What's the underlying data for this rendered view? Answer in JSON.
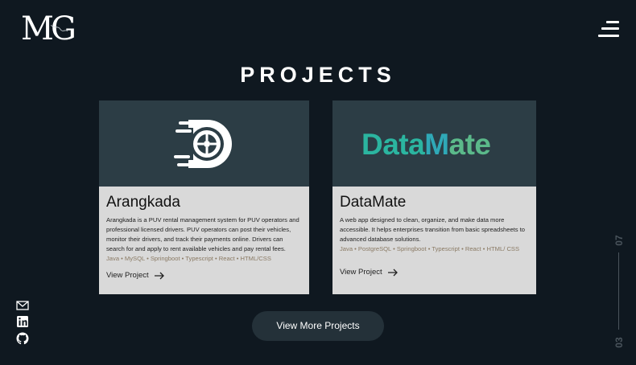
{
  "header": {
    "logo_text": "MG",
    "logo_script": "Riotamma"
  },
  "section": {
    "title": "PROJECTS"
  },
  "projects": [
    {
      "name": "Arangkada",
      "description": "Arangkada is a PUV rental management system for PUV operators and professional licensed drivers. PUV operators can post their vehicles, monitor their drivers, and track their payments online. Drivers can search for and apply to rent available vehicles and pay rental fees.",
      "tech": "Java • MySQL • Springboot • Typescript • React • HTML/CSS",
      "link_label": "View Project"
    },
    {
      "name": "DataMate",
      "description": "A web app designed to clean, organize, and make data more accessible. It helps enterprises transition from basic spreadsheets to advanced database solutions.",
      "tech": "Java • PostgreSQL • Springboot • Typescript • React • HTML/ CSS",
      "link_label": "View Project",
      "logo_parts": [
        "Data",
        "M",
        "ate"
      ]
    }
  ],
  "cta": {
    "more_label": "View More Projects"
  },
  "pagination": {
    "current": "03",
    "total": "07"
  },
  "colors": {
    "background": "#0f1820",
    "card": "#d9d9d9",
    "banner": "#2c3d45",
    "button": "#243139",
    "tech_text": "#8a7a64"
  }
}
